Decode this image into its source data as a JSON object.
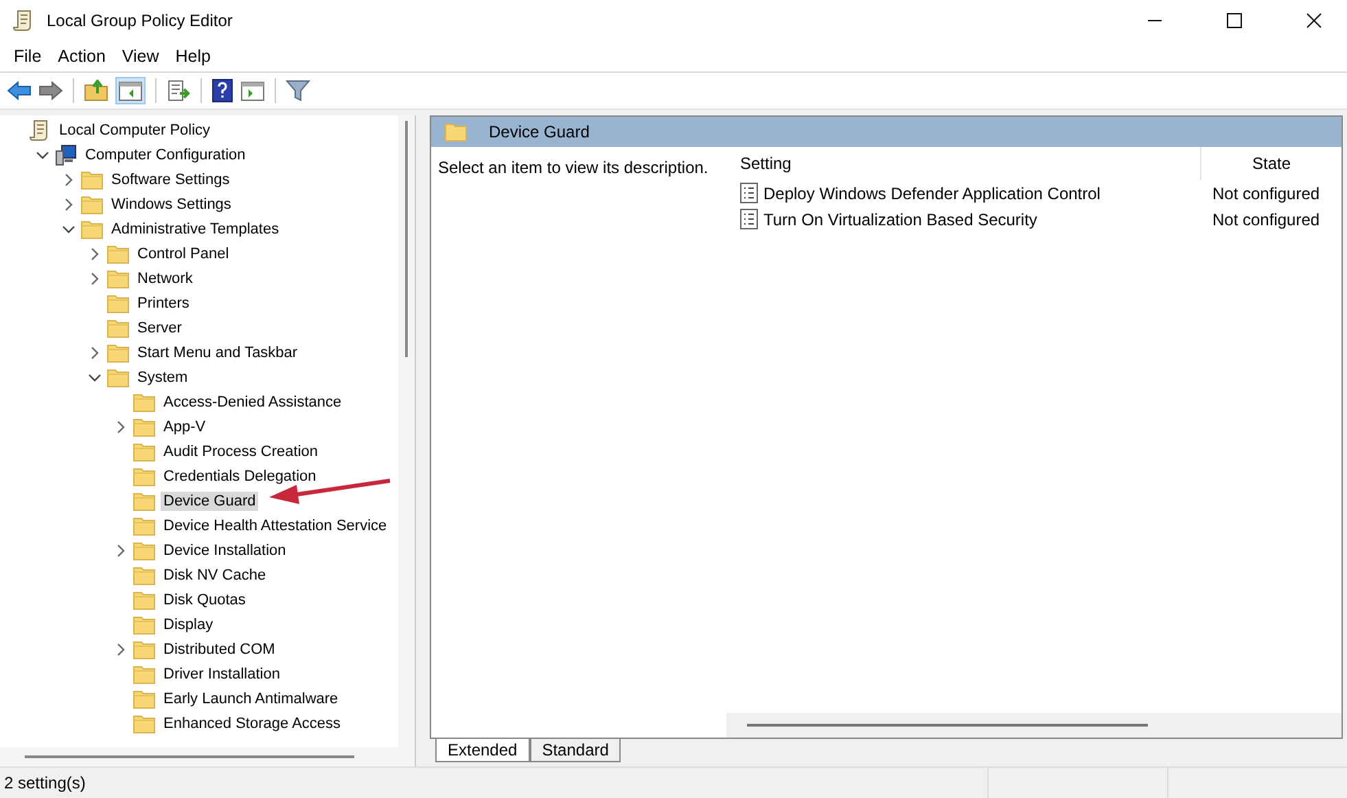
{
  "window": {
    "title": "Local Group Policy Editor"
  },
  "menu": [
    "File",
    "Action",
    "View",
    "Help"
  ],
  "tree": [
    {
      "label": "Local Computer Policy",
      "kind": "policy",
      "selected": false,
      "children": [
        {
          "label": "Computer Configuration",
          "kind": "computer",
          "expanded": true,
          "selected": false,
          "children": [
            {
              "label": "Software Settings",
              "kind": "folder",
              "expanded": false,
              "selected": false
            },
            {
              "label": "Windows Settings",
              "kind": "folder",
              "expanded": false,
              "selected": false
            },
            {
              "label": "Administrative Templates",
              "kind": "folder",
              "expanded": true,
              "selected": false,
              "children": [
                {
                  "label": "Control Panel",
                  "kind": "folder",
                  "expanded": false,
                  "selected": false
                },
                {
                  "label": "Network",
                  "kind": "folder",
                  "expanded": false,
                  "selected": false
                },
                {
                  "label": "Printers",
                  "kind": "folder",
                  "selected": false
                },
                {
                  "label": "Server",
                  "kind": "folder",
                  "selected": false
                },
                {
                  "label": "Start Menu and Taskbar",
                  "kind": "folder",
                  "expanded": false,
                  "selected": false
                },
                {
                  "label": "System",
                  "kind": "folder",
                  "expanded": true,
                  "selected": false,
                  "children": [
                    {
                      "label": "Access-Denied Assistance",
                      "kind": "folder",
                      "selected": false
                    },
                    {
                      "label": "App-V",
                      "kind": "folder",
                      "expanded": false,
                      "selected": false
                    },
                    {
                      "label": "Audit Process Creation",
                      "kind": "folder",
                      "selected": false
                    },
                    {
                      "label": "Credentials Delegation",
                      "kind": "folder",
                      "selected": false
                    },
                    {
                      "label": "Device Guard",
                      "kind": "folder",
                      "selected": true
                    },
                    {
                      "label": "Device Health Attestation Service",
                      "kind": "folder",
                      "selected": false
                    },
                    {
                      "label": "Device Installation",
                      "kind": "folder",
                      "expanded": false,
                      "selected": false
                    },
                    {
                      "label": "Disk NV Cache",
                      "kind": "folder",
                      "selected": false
                    },
                    {
                      "label": "Disk Quotas",
                      "kind": "folder",
                      "selected": false
                    },
                    {
                      "label": "Display",
                      "kind": "folder",
                      "selected": false
                    },
                    {
                      "label": "Distributed COM",
                      "kind": "folder",
                      "expanded": false,
                      "selected": false
                    },
                    {
                      "label": "Driver Installation",
                      "kind": "folder",
                      "selected": false
                    },
                    {
                      "label": "Early Launch Antimalware",
                      "kind": "folder",
                      "selected": false
                    },
                    {
                      "label": "Enhanced Storage Access",
                      "kind": "folder",
                      "selected": false
                    }
                  ]
                }
              ]
            }
          ]
        }
      ]
    }
  ],
  "details": {
    "title": "Device Guard",
    "description": "Select an item to view its description.",
    "columns": [
      "Setting",
      "State"
    ],
    "rows": [
      {
        "setting": "Deploy Windows Defender Application Control",
        "state": "Not configured"
      },
      {
        "setting": "Turn On Virtualization Based Security",
        "state": "Not configured"
      }
    ]
  },
  "view_tabs": [
    {
      "label": "Extended",
      "selected": true
    },
    {
      "label": "Standard",
      "selected": false
    }
  ],
  "status_bar": "2 setting(s)"
}
